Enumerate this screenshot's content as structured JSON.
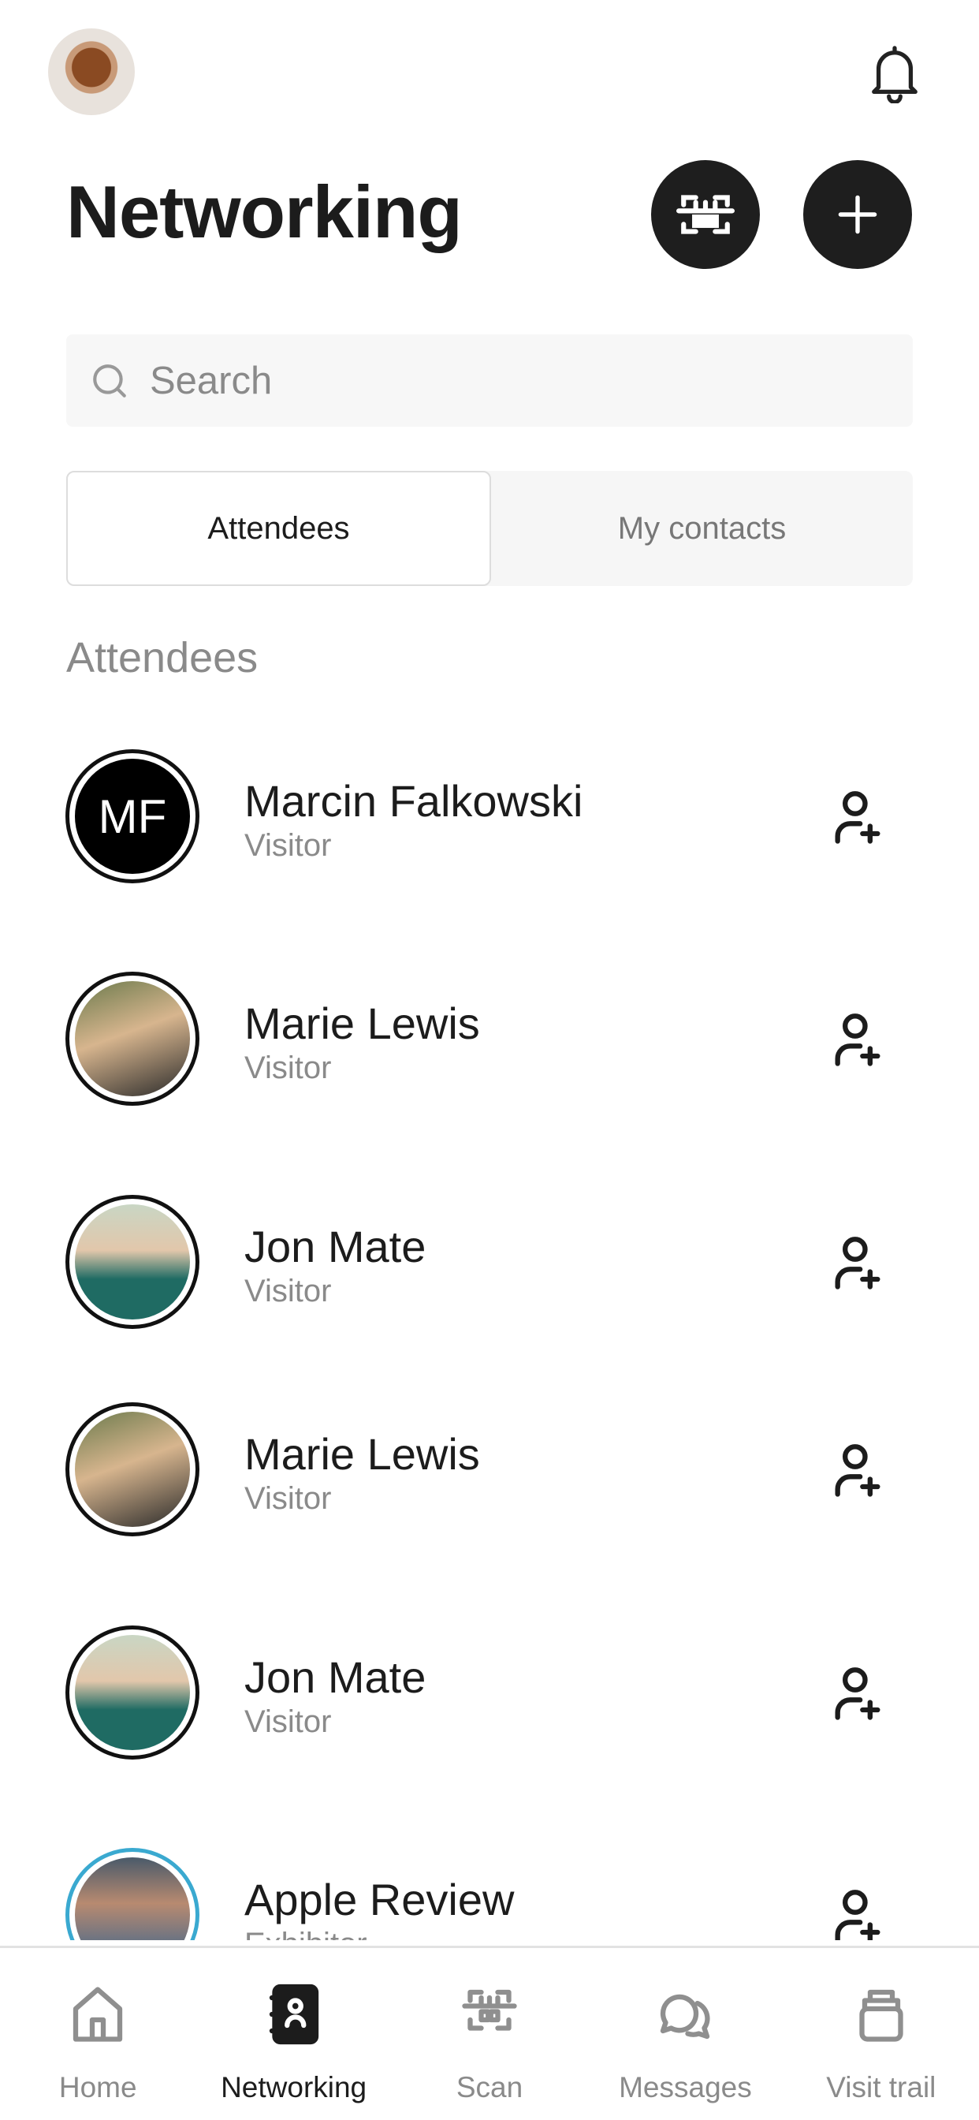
{
  "header": {
    "title": "Networking",
    "avatar": "user-avatar",
    "bell": "bell-icon",
    "scan_button": "scan-icon",
    "add_button": "plus-icon"
  },
  "search": {
    "placeholder": "Search",
    "value": ""
  },
  "tabs": [
    {
      "label": "Attendees",
      "active": true
    },
    {
      "label": "My contacts",
      "active": false
    }
  ],
  "section_title": "Attendees",
  "attendees": [
    {
      "name": "Marcin Falkowski",
      "role": "Visitor",
      "initials": "MF",
      "ring": "#111111"
    },
    {
      "name": "Marie Lewis",
      "role": "Visitor",
      "initials": "",
      "ring": "#111111"
    },
    {
      "name": "Jon Mate",
      "role": "Visitor",
      "initials": "",
      "ring": "#111111"
    },
    {
      "name": "Marie Lewis",
      "role": "Visitor",
      "initials": "",
      "ring": "#111111"
    },
    {
      "name": "Jon Mate",
      "role": "Visitor",
      "initials": "",
      "ring": "#111111"
    },
    {
      "name": "Apple Review",
      "role": "Exhibitor",
      "initials": "",
      "ring": "#3aa9d0"
    }
  ],
  "nav": [
    {
      "label": "Home",
      "icon": "home-icon",
      "active": false
    },
    {
      "label": "Networking",
      "icon": "contacts-book-icon",
      "active": true
    },
    {
      "label": "Scan",
      "icon": "scan-icon",
      "active": false
    },
    {
      "label": "Messages",
      "icon": "chat-icon",
      "active": false
    },
    {
      "label": "Visit trail",
      "icon": "stack-icon",
      "active": false
    }
  ]
}
